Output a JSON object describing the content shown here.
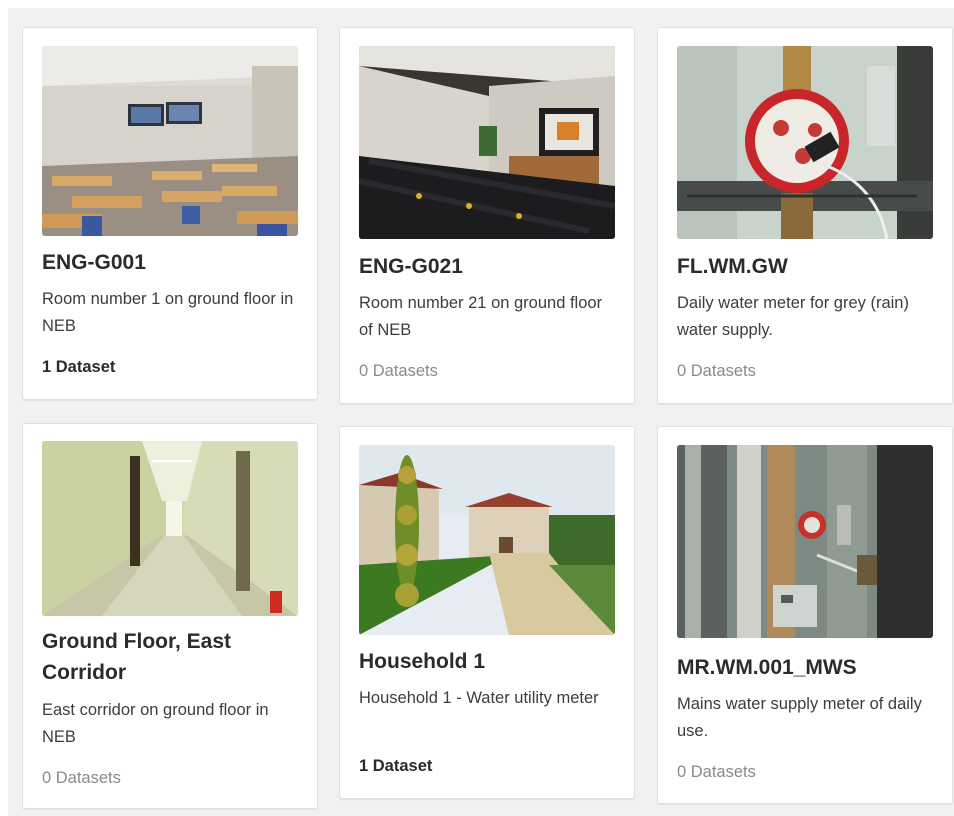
{
  "cards": [
    {
      "title": "ENG-G001",
      "description": "Room number 1 on ground floor in NEB",
      "datasets": "1 Dataset",
      "image": "classroom-photo"
    },
    {
      "title": "ENG-G021",
      "description": "Room number 21 on ground floor of NEB",
      "datasets": "0 Datasets",
      "image": "lecture-hall-photo"
    },
    {
      "title": "FL.WM.GW",
      "description": "Daily water meter for grey (rain) water supply.",
      "datasets": "0 Datasets",
      "image": "water-meter-photo"
    },
    {
      "title": "Ground Floor, East Corridor",
      "description": "East corridor on ground floor in NEB",
      "datasets": "0 Datasets",
      "image": "corridor-photo"
    },
    {
      "title": "Household 1",
      "description": "Household 1 - Water utility meter",
      "datasets": "1 Dataset",
      "image": "house-photo"
    },
    {
      "title": "MR.WM.001_MWS",
      "description": "Mains water supply meter of daily use.",
      "datasets": "0 Datasets",
      "image": "pipes-meter-photo"
    }
  ],
  "colors": {
    "card_bg": "#ffffff",
    "page_bg": "#f1f1f1",
    "title": "#2b2b2b",
    "muted": "#8a8a8a"
  }
}
